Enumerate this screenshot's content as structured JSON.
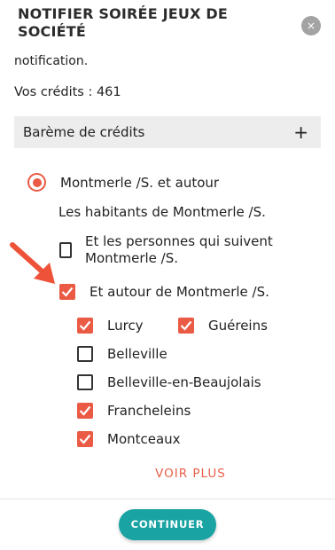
{
  "header": {
    "title": "NOTIFIER SOIRÉE JEUX DE SOCIÉTÉ",
    "close_icon": "close-icon",
    "close_glyph": "×"
  },
  "intro": {
    "clipped_text": "Les utilisateurs ciblés recevront une notification.",
    "credits": "Vos crédits : 461"
  },
  "scale": {
    "label": "Barème de crédits",
    "expand_glyph": "+"
  },
  "targeting": {
    "radio_label": "Montmerle /S. et autour",
    "radio_selected": true,
    "residents_label": "Les habitants de Montmerle /S.",
    "followers_label": "Et les personnes qui suivent Montmerle /S.",
    "followers_checked": false,
    "around_label": "Et autour de Montmerle /S.",
    "around_checked": true,
    "towns": [
      {
        "label": "Lurcy",
        "checked": true
      },
      {
        "label": "Guéreins",
        "checked": true
      },
      {
        "label": "Belleville",
        "checked": false
      },
      {
        "label": "Belleville-en-Beaujolais",
        "checked": false
      },
      {
        "label": "Francheleins",
        "checked": true
      },
      {
        "label": "Montceaux",
        "checked": true
      }
    ],
    "see_more": "VOIR PLUS"
  },
  "footer": {
    "continue_label": "CONTINUER"
  },
  "colors": {
    "accent": "#ea5a44",
    "primary_button": "#19a3a3",
    "close_button": "#a3a3a3",
    "scale_bar": "#ededed"
  }
}
